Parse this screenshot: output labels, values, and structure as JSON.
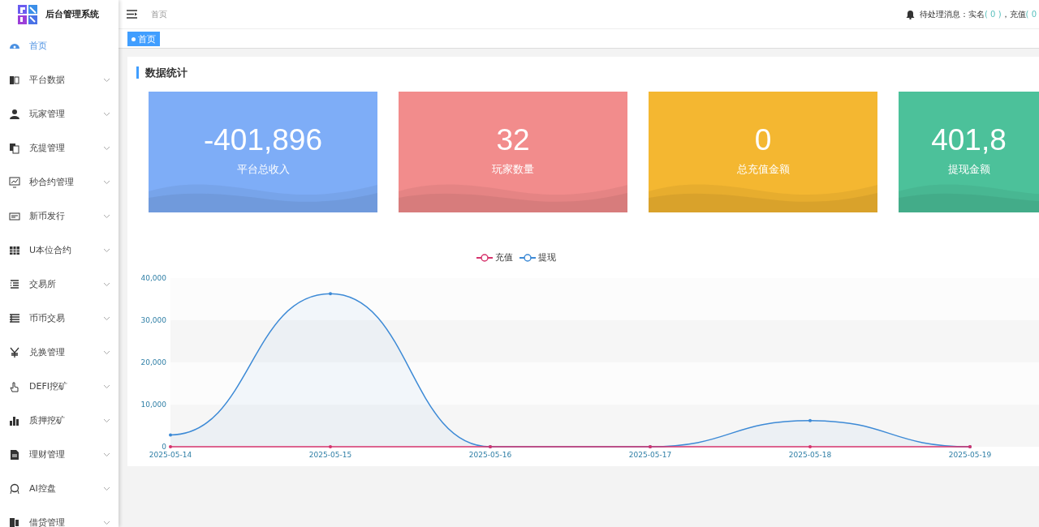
{
  "brand": {
    "title": "后台管理系统"
  },
  "sidebar": {
    "items": [
      {
        "label": "首页",
        "selected": true,
        "expandable": false
      },
      {
        "label": "平台数据",
        "selected": false,
        "expandable": true
      },
      {
        "label": "玩家管理",
        "selected": false,
        "expandable": true
      },
      {
        "label": "充提管理",
        "selected": false,
        "expandable": true
      },
      {
        "label": "秒合约管理",
        "selected": false,
        "expandable": true
      },
      {
        "label": "新币发行",
        "selected": false,
        "expandable": true
      },
      {
        "label": "U本位合约",
        "selected": false,
        "expandable": true
      },
      {
        "label": "交易所",
        "selected": false,
        "expandable": true
      },
      {
        "label": "币币交易",
        "selected": false,
        "expandable": true
      },
      {
        "label": "兑换管理",
        "selected": false,
        "expandable": true
      },
      {
        "label": "DEFI挖矿",
        "selected": false,
        "expandable": true
      },
      {
        "label": "质押挖矿",
        "selected": false,
        "expandable": true
      },
      {
        "label": "理财管理",
        "selected": false,
        "expandable": true
      },
      {
        "label": "AI控盘",
        "selected": false,
        "expandable": true
      },
      {
        "label": "借贷管理",
        "selected": false,
        "expandable": true
      }
    ]
  },
  "header": {
    "breadcrumb": "首页",
    "notice": {
      "label": "待处理消息：",
      "items": [
        {
          "label": "实名",
          "count": "( 0 )"
        },
        {
          "label": "，充值",
          "count": "( 0"
        }
      ]
    }
  },
  "tabs": [
    {
      "label": "首页",
      "selected": true
    }
  ],
  "panel": {
    "title": "数据统计",
    "cards": [
      {
        "value": "-401,896",
        "label": "平台总收入",
        "color": "#7eadf7"
      },
      {
        "value": "32",
        "label": "玩家数量",
        "color": "#f28c8c"
      },
      {
        "value": "0",
        "label": "总充值金额",
        "color": "#f4b731"
      },
      {
        "value": "401,8",
        "label": "提现金额",
        "color": "#4cc19a"
      }
    ],
    "chart_data": {
      "type": "line",
      "categories": [
        "2025-05-14",
        "2025-05-15",
        "2025-05-16",
        "2025-05-17",
        "2025-05-18",
        "2025-05-19"
      ],
      "yticks": [
        0,
        {
          "value": 10000,
          "label": "10,000"
        },
        {
          "value": 20000,
          "label": "20,000"
        },
        {
          "value": 30000,
          "label": "30,000"
        },
        {
          "value": 40000,
          "label": "40,000"
        }
      ],
      "ylim": [
        0,
        40000
      ],
      "series": [
        {
          "name": "充值",
          "color": "#d6336c",
          "values": [
            0,
            0,
            0,
            0,
            0,
            0
          ]
        },
        {
          "name": "提现",
          "color": "#3d8ad6",
          "values": [
            2800,
            36300,
            0,
            0,
            6200,
            0
          ]
        }
      ]
    }
  }
}
